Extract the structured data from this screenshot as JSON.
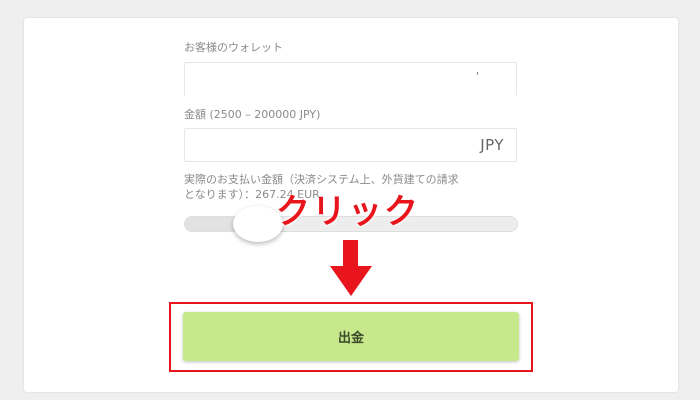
{
  "wallet": {
    "label": "お客様のウォレット",
    "value": "'"
  },
  "amount": {
    "label": "金額 (2500 – 200000 JPY)",
    "currency": "JPY"
  },
  "actual_payment": {
    "text_line1": "実際のお支払い金額（決済システム上、外貨建ての請求",
    "text_line2": "となります）：267.24 EUR"
  },
  "slider": {
    "level_fraction": 0.2
  },
  "annotation": {
    "text": "クリック",
    "color": "#e8161c"
  },
  "withdraw_button": {
    "label": "出金",
    "color": "#c7e98c"
  }
}
